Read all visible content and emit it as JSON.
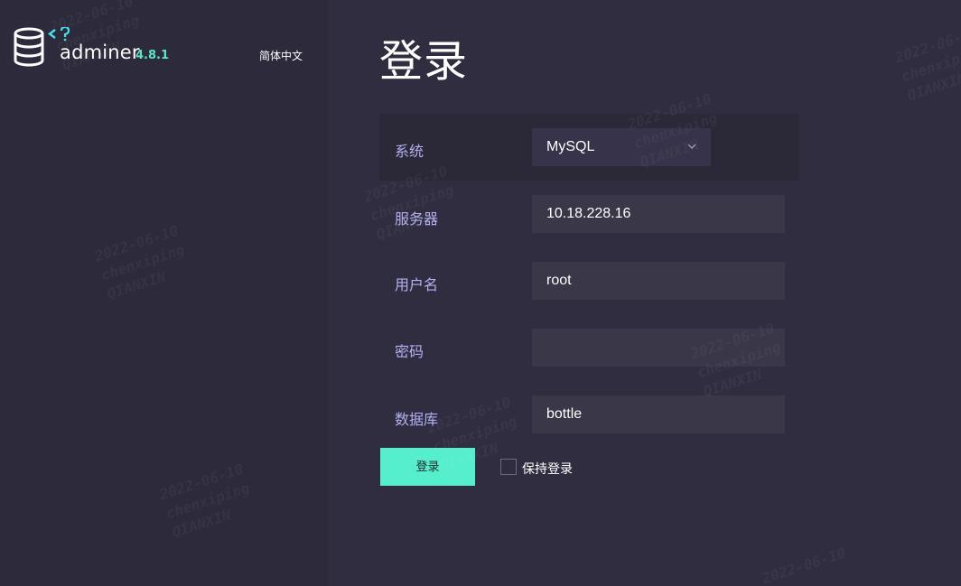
{
  "header": {
    "app_name": "adminer",
    "version": "4.8.1",
    "language": "简体中文"
  },
  "page": {
    "title": "登录"
  },
  "form": {
    "system_label": "系统",
    "system_value": "MySQL",
    "server_label": "服务器",
    "server_value": "10.18.228.16",
    "username_label": "用户名",
    "username_value": "root",
    "password_label": "密码",
    "password_value": "",
    "database_label": "数据库",
    "database_value": "bottle",
    "login_button": "登录",
    "remember_label": "保持登录"
  },
  "watermark": {
    "date": "2022-06-10",
    "user": "chenxiping",
    "org": "QIANXIN"
  },
  "colors": {
    "accent": "#55efcd",
    "label": "#b3b0f0",
    "background": "#302d40"
  },
  "icons": {
    "logo": "database-icon",
    "select_arrow": "chevron-down-icon"
  }
}
